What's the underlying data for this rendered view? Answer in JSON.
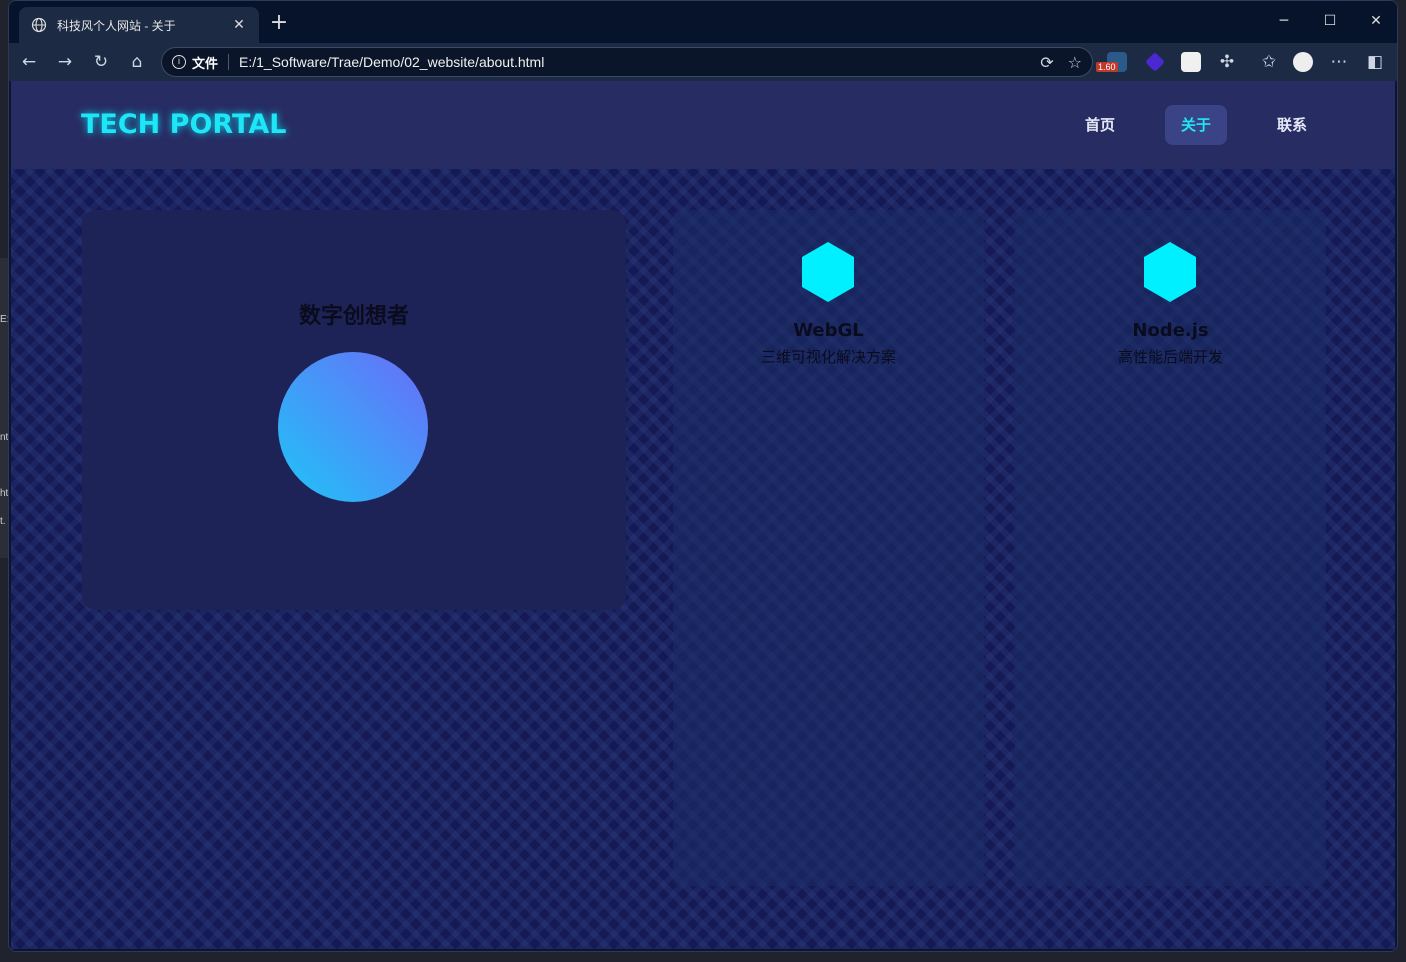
{
  "browser": {
    "tab_title": "科技风个人网站 - 关于",
    "url_label": "文件",
    "url": "E:/1_Software/Trae/Demo/02_website/about.html",
    "ext_badge": "1.60"
  },
  "desktop": {
    "fragments": [
      "E:",
      "nt",
      "ht",
      "t."
    ]
  },
  "site": {
    "logo": "TECH PORTAL",
    "nav": [
      {
        "label": "首页"
      },
      {
        "label": "关于",
        "active": true
      },
      {
        "label": "联系"
      }
    ],
    "profile": {
      "title": "数字创想者"
    },
    "tech": [
      {
        "name": "WebGL",
        "desc": "三维可视化解决方案",
        "icon": "hexagon-icon"
      },
      {
        "name": "Node.js",
        "desc": "高性能后端开发",
        "icon": "hexagon-icon"
      }
    ]
  },
  "colors": {
    "accent": "#00f0ff",
    "page_bg": "#151a55",
    "header_bg": "#272c63",
    "card_bg": "#1e2357"
  }
}
